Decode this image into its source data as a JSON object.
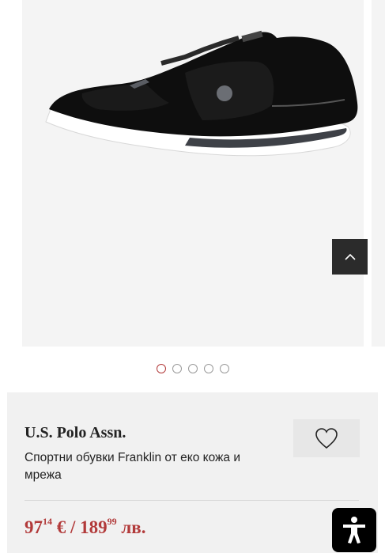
{
  "product": {
    "brand": "U.S. Polo Assn.",
    "title": "Спортни обувки Franklin от еко кожа и мрежа",
    "price": {
      "eur_int": "97",
      "eur_dec": "14",
      "eur_symbol": "€",
      "separator": "/",
      "bgn_int": "189",
      "bgn_dec": "99",
      "bgn_symbol": "лв."
    }
  },
  "gallery": {
    "image_count": 5,
    "active_index": 0
  },
  "icons": {
    "scroll_top": "chevron-up-icon",
    "favorite": "heart-outline-icon",
    "accessibility": "accessibility-person-icon"
  },
  "colors": {
    "accent": "#b23a3a",
    "card_bg": "#f1f1f1",
    "dark_button": "#2b2b2b"
  }
}
